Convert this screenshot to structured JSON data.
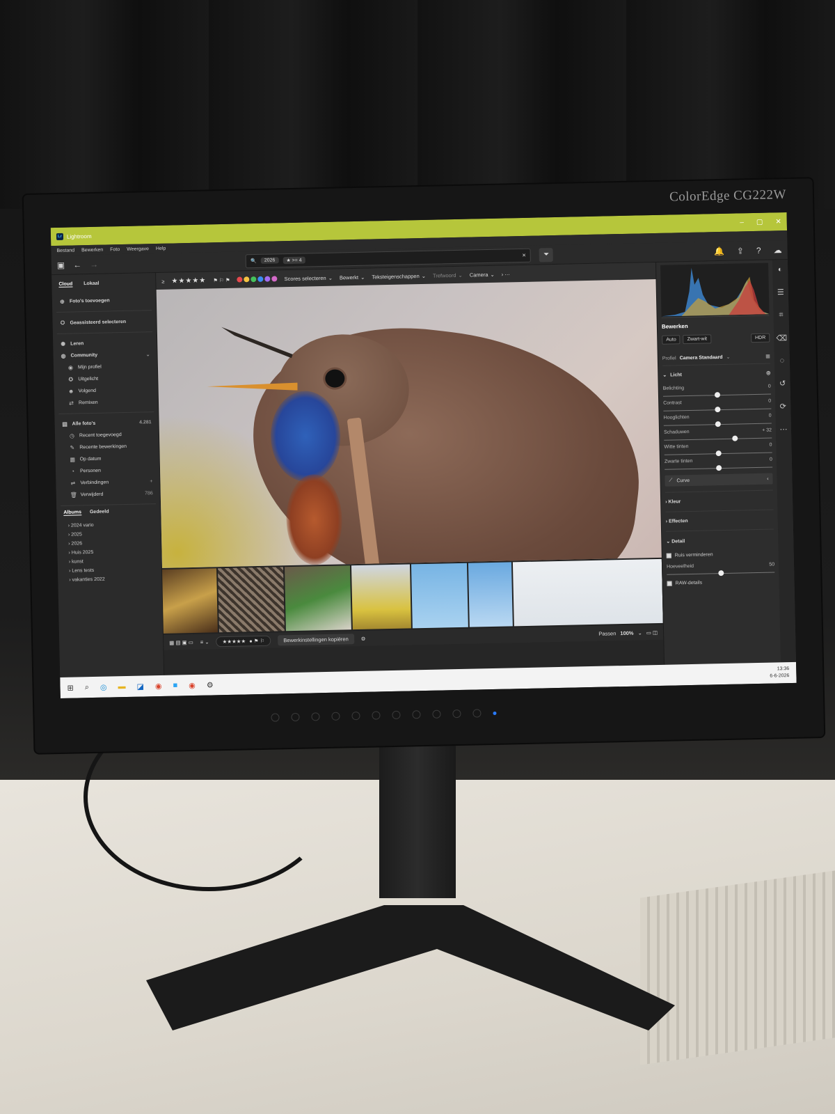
{
  "monitor": {
    "brand": "ColorEdge CG222W"
  },
  "app": {
    "title": "Lightroom",
    "window_controls": [
      "–",
      "▢",
      "✕"
    ]
  },
  "menu": [
    "Bestand",
    "Bewerken",
    "Foto",
    "Weergave",
    "Help"
  ],
  "search": {
    "chip1": "2026",
    "chip2": "★ >= 4",
    "clear": "✕"
  },
  "sidebar": {
    "tab_cloud": "Cloud",
    "tab_local": "Lokaal",
    "add_photos": "Foto's toevoegen",
    "assisted_select": "Geassisteerd selecteren",
    "learn": "Leren",
    "community": "Community",
    "community_items": [
      "Mijn profiel",
      "Uitgelicht",
      "Volgend",
      "Remixen"
    ],
    "all_photos": "Alle foto's",
    "all_photos_count": "4.281",
    "library_items": [
      "Recent toegevoegd",
      "Recente bewerkingen",
      "Op datum",
      "Personen",
      "Verbindingen",
      "Verwijderd"
    ],
    "deleted_count": "786",
    "albums_tab": "Albums",
    "shared_tab": "Gedeeld",
    "albums": [
      "2024 vario",
      "2025",
      "2026",
      "Huis 2025",
      "kunst",
      "Lens tests",
      "vakanties 2022"
    ]
  },
  "filterbar": {
    "rating_op": "≥",
    "stars": "★★★★★",
    "scores": "Scores selecteren",
    "edited": "Bewerkt",
    "text_props": "Teksteigenschappen",
    "keyword": "Trefwoord",
    "camera": "Camera",
    "more": "›  ···",
    "color_labels": [
      "#e5484d",
      "#f5c342",
      "#45c25b",
      "#3b8cf0",
      "#a46cf0",
      "#d46ac8"
    ]
  },
  "bottombar": {
    "stars": "★★★★★",
    "copy_edits": "Bewerkinstellingen kopiëren",
    "fit": "Passen",
    "zoom": "100%"
  },
  "edit_panel": {
    "title": "Bewerken",
    "auto": "Auto",
    "bw": "Zwart-wit",
    "hdr": "HDR",
    "profile_label": "Profiel",
    "profile_value": "Camera Standaard",
    "light_section": "Licht",
    "sliders": [
      {
        "label": "Belichting",
        "value": "0",
        "pos": 0.5
      },
      {
        "label": "Contrast",
        "value": "0",
        "pos": 0.5
      },
      {
        "label": "Hooglichten",
        "value": "0",
        "pos": 0.5
      },
      {
        "label": "Schaduwen",
        "value": "+ 32",
        "pos": 0.66
      },
      {
        "label": "Witte tinten",
        "value": "0",
        "pos": 0.5
      },
      {
        "label": "Zwarte tinten",
        "value": "0",
        "pos": 0.5
      }
    ],
    "curve": "Curve",
    "color": "Kleur",
    "effects": "Effecten",
    "detail": "Detail",
    "noise_reduction": "Ruis verminderen",
    "amount_label": "Hoeveelheid",
    "amount_value": "50",
    "amount_pos": 0.5,
    "raw_details": "RAW-details"
  },
  "taskbar": {
    "time": "13:36",
    "date": "6-6-2026"
  }
}
